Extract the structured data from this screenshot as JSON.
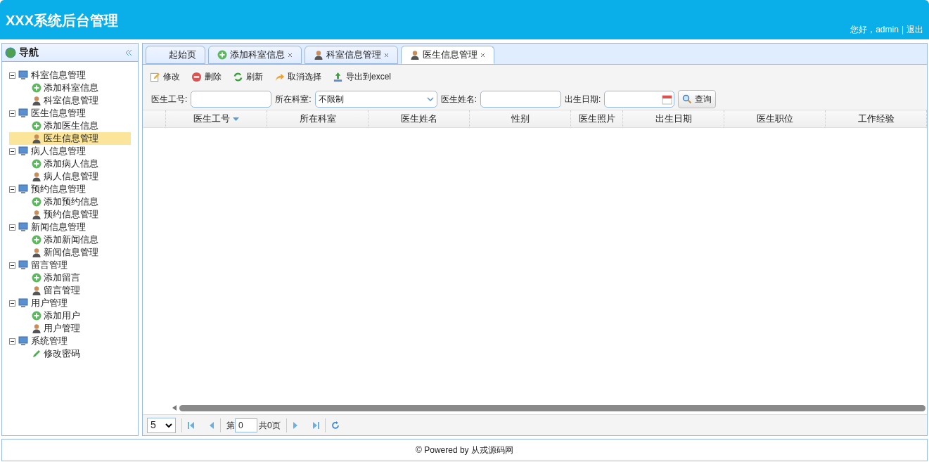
{
  "header": {
    "title": "XXX系统后台管理",
    "greeting": "您好，admin",
    "separator": "|",
    "logout": "退出"
  },
  "nav": {
    "title": "导航",
    "groups": [
      {
        "label": "科室信息管理",
        "expanded": true,
        "children": [
          {
            "kind": "add",
            "label": "添加科室信息",
            "selected": false
          },
          {
            "kind": "manage",
            "label": "科室信息管理",
            "selected": false
          }
        ]
      },
      {
        "label": "医生信息管理",
        "expanded": true,
        "children": [
          {
            "kind": "add",
            "label": "添加医生信息",
            "selected": false
          },
          {
            "kind": "manage",
            "label": "医生信息管理",
            "selected": true
          }
        ]
      },
      {
        "label": "病人信息管理",
        "expanded": true,
        "children": [
          {
            "kind": "add",
            "label": "添加病人信息",
            "selected": false
          },
          {
            "kind": "manage",
            "label": "病人信息管理",
            "selected": false
          }
        ]
      },
      {
        "label": "预约信息管理",
        "expanded": true,
        "children": [
          {
            "kind": "add",
            "label": "添加预约信息",
            "selected": false
          },
          {
            "kind": "manage",
            "label": "预约信息管理",
            "selected": false
          }
        ]
      },
      {
        "label": "新闻信息管理",
        "expanded": true,
        "children": [
          {
            "kind": "add",
            "label": "添加新闻信息",
            "selected": false
          },
          {
            "kind": "manage",
            "label": "新闻信息管理",
            "selected": false
          }
        ]
      },
      {
        "label": "留言管理",
        "expanded": true,
        "children": [
          {
            "kind": "add",
            "label": "添加留言",
            "selected": false
          },
          {
            "kind": "manage",
            "label": "留言管理",
            "selected": false
          }
        ]
      },
      {
        "label": "用户管理",
        "expanded": true,
        "children": [
          {
            "kind": "add",
            "label": "添加用户",
            "selected": false
          },
          {
            "kind": "manage",
            "label": "用户管理",
            "selected": false
          }
        ]
      },
      {
        "label": "系统管理",
        "expanded": true,
        "children": [
          {
            "kind": "edit",
            "label": "修改密码",
            "selected": false
          }
        ]
      }
    ]
  },
  "tabs": [
    {
      "kind": "home",
      "label": "起始页",
      "selected": false,
      "closable": false
    },
    {
      "kind": "add",
      "label": "添加科室信息",
      "selected": false,
      "closable": true
    },
    {
      "kind": "manage",
      "label": "科室信息管理",
      "selected": false,
      "closable": true
    },
    {
      "kind": "manage",
      "label": "医生信息管理",
      "selected": true,
      "closable": true
    }
  ],
  "toolbar": [
    {
      "kind": "edit",
      "label": "修改"
    },
    {
      "kind": "delete",
      "label": "删除"
    },
    {
      "kind": "refresh",
      "label": "刷新"
    },
    {
      "kind": "undo",
      "label": "取消选择"
    },
    {
      "kind": "export",
      "label": "导出到excel"
    }
  ],
  "filters": [
    {
      "kind": "text",
      "label": "医生工号:"
    },
    {
      "kind": "select",
      "label": "所在科室:",
      "value": "不限制"
    },
    {
      "kind": "text",
      "label": "医生姓名:"
    },
    {
      "kind": "date",
      "label": "出生日期:"
    }
  ],
  "search_button": "查询",
  "table": {
    "columns": [
      {
        "label": "医生工号",
        "sorted": true
      },
      {
        "label": "所在科室",
        "sorted": false
      },
      {
        "label": "医生姓名",
        "sorted": false
      },
      {
        "label": "性别",
        "sorted": false
      },
      {
        "label": "医生照片",
        "sorted": false
      },
      {
        "label": "出生日期",
        "sorted": false
      },
      {
        "label": "医生职位",
        "sorted": false
      },
      {
        "label": "工作经验",
        "sorted": false
      }
    ]
  },
  "pager": {
    "page_size": "5",
    "page_prefix": "第",
    "page": "0",
    "total": "共0页"
  },
  "footer": "© Powered by 从戎源码网"
}
